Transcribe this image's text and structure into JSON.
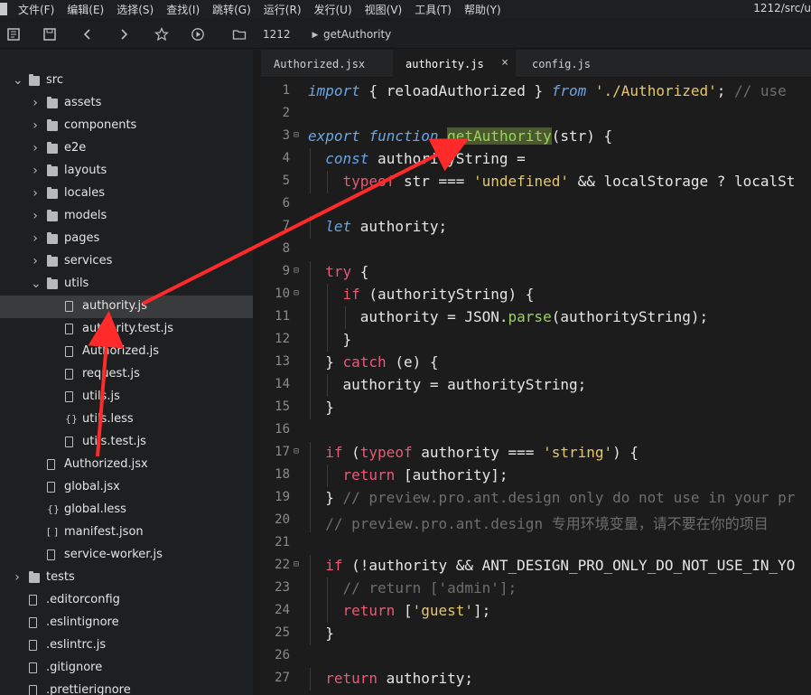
{
  "menubar": {
    "items": [
      "文件(F)",
      "编辑(E)",
      "选择(S)",
      "查找(I)",
      "跳转(G)",
      "运行(R)",
      "发行(U)",
      "视图(V)",
      "工具(T)",
      "帮助(Y)"
    ],
    "path_text": "1212/src/u"
  },
  "toolbar": {
    "project_label": "1212",
    "breadcrumb_label": "getAuthority",
    "icons": [
      "sidebar-toggle-icon",
      "save-icon",
      "back-icon",
      "forward-icon",
      "star-icon",
      "play-icon",
      "folder-view-icon",
      "chevron-right-icon"
    ]
  },
  "sidebar": {
    "items": [
      {
        "label": "src",
        "type": "folder",
        "expanded": true,
        "level": 0
      },
      {
        "label": "assets",
        "type": "folder",
        "expanded": false,
        "level": 1
      },
      {
        "label": "components",
        "type": "folder",
        "expanded": false,
        "level": 1
      },
      {
        "label": "e2e",
        "type": "folder",
        "expanded": false,
        "level": 1
      },
      {
        "label": "layouts",
        "type": "folder",
        "expanded": false,
        "level": 1
      },
      {
        "label": "locales",
        "type": "folder",
        "expanded": false,
        "level": 1
      },
      {
        "label": "models",
        "type": "folder",
        "expanded": false,
        "level": 1
      },
      {
        "label": "pages",
        "type": "folder",
        "expanded": false,
        "level": 1
      },
      {
        "label": "services",
        "type": "folder",
        "expanded": false,
        "level": 1
      },
      {
        "label": "utils",
        "type": "folder",
        "expanded": true,
        "level": 1
      },
      {
        "label": "authority.js",
        "type": "file",
        "level": 2,
        "selected": true
      },
      {
        "label": "authority.test.js",
        "type": "file",
        "level": 2
      },
      {
        "label": "Authorized.js",
        "type": "file",
        "level": 2
      },
      {
        "label": "request.js",
        "type": "file",
        "level": 2
      },
      {
        "label": "utils.js",
        "type": "file",
        "level": 2
      },
      {
        "label": "utils.less",
        "type": "brace",
        "level": 2
      },
      {
        "label": "utils.test.js",
        "type": "file",
        "level": 2
      },
      {
        "label": "Authorized.jsx",
        "type": "file",
        "level": 1
      },
      {
        "label": "global.jsx",
        "type": "file",
        "level": 1
      },
      {
        "label": "global.less",
        "type": "brace",
        "level": 1
      },
      {
        "label": "manifest.json",
        "type": "bracket",
        "level": 1
      },
      {
        "label": "service-worker.js",
        "type": "file",
        "level": 1
      },
      {
        "label": "tests",
        "type": "folder",
        "expanded": false,
        "level": 0
      },
      {
        "label": ".editorconfig",
        "type": "file",
        "level": 0
      },
      {
        "label": ".eslintignore",
        "type": "file",
        "level": 0
      },
      {
        "label": ".eslintrc.js",
        "type": "file",
        "level": 0
      },
      {
        "label": ".gitignore",
        "type": "file",
        "level": 0
      },
      {
        "label": ".prettierignore",
        "type": "file",
        "level": 0
      }
    ]
  },
  "tabs": [
    {
      "label": "Authorized.jsx",
      "active": false
    },
    {
      "label": "authority.js",
      "active": true,
      "close": "×"
    },
    {
      "label": "config.js",
      "active": false
    }
  ],
  "code": [
    {
      "n": "1",
      "fold": "",
      "indent": 0,
      "tokens": [
        [
          "kw",
          "import"
        ],
        [
          "p",
          " { reloadAuthorized } "
        ],
        [
          "kw",
          "from"
        ],
        [
          "p",
          " "
        ],
        [
          "str",
          "'./Authorized'"
        ],
        [
          "p",
          "; "
        ],
        [
          "cm",
          "// use"
        ]
      ]
    },
    {
      "n": "2",
      "fold": "",
      "indent": 0,
      "tokens": []
    },
    {
      "n": "3",
      "fold": "⊟",
      "indent": 0,
      "tokens": [
        [
          "kw",
          "export"
        ],
        [
          "p",
          " "
        ],
        [
          "kw",
          "function"
        ],
        [
          "p",
          " "
        ],
        [
          "hlfn",
          "getAuthority"
        ],
        [
          "p",
          "(str) {"
        ]
      ]
    },
    {
      "n": "4",
      "fold": "",
      "indent": 1,
      "tokens": [
        [
          "kw",
          "const"
        ],
        [
          "p",
          " authorityString ="
        ]
      ]
    },
    {
      "n": "5",
      "fold": "",
      "indent": 2,
      "tokens": [
        [
          "kwr",
          "typeof"
        ],
        [
          "p",
          " str === "
        ],
        [
          "str",
          "'undefined'"
        ],
        [
          "p",
          " && localStorage ? localSt"
        ]
      ]
    },
    {
      "n": "6",
      "fold": "",
      "indent": 0,
      "tokens": []
    },
    {
      "n": "7",
      "fold": "",
      "indent": 1,
      "tokens": [
        [
          "kw",
          "let"
        ],
        [
          "p",
          " authority;"
        ]
      ]
    },
    {
      "n": "8",
      "fold": "",
      "indent": 0,
      "tokens": []
    },
    {
      "n": "9",
      "fold": "⊟",
      "indent": 1,
      "tokens": [
        [
          "kwr",
          "try"
        ],
        [
          "p",
          " {"
        ]
      ]
    },
    {
      "n": "10",
      "fold": "⊟",
      "indent": 2,
      "tokens": [
        [
          "kwr",
          "if"
        ],
        [
          "p",
          " (authorityString) {"
        ]
      ]
    },
    {
      "n": "11",
      "fold": "",
      "indent": 3,
      "tokens": [
        [
          "p",
          "authority = JSON."
        ],
        [
          "fn",
          "parse"
        ],
        [
          "p",
          "(authorityString);"
        ]
      ]
    },
    {
      "n": "12",
      "fold": "",
      "indent": 2,
      "tokens": [
        [
          "p",
          "}"
        ]
      ]
    },
    {
      "n": "13",
      "fold": "",
      "indent": 1,
      "tokens": [
        [
          "p",
          "} "
        ],
        [
          "kwr",
          "catch"
        ],
        [
          "p",
          " (e) {"
        ]
      ]
    },
    {
      "n": "14",
      "fold": "",
      "indent": 2,
      "tokens": [
        [
          "p",
          "authority = authorityString;"
        ]
      ]
    },
    {
      "n": "15",
      "fold": "",
      "indent": 1,
      "tokens": [
        [
          "p",
          "}"
        ]
      ]
    },
    {
      "n": "16",
      "fold": "",
      "indent": 0,
      "tokens": []
    },
    {
      "n": "17",
      "fold": "⊟",
      "indent": 1,
      "tokens": [
        [
          "kwr",
          "if"
        ],
        [
          "p",
          " ("
        ],
        [
          "kwr",
          "typeof"
        ],
        [
          "p",
          " authority === "
        ],
        [
          "str",
          "'string'"
        ],
        [
          "p",
          ") {"
        ]
      ]
    },
    {
      "n": "18",
      "fold": "",
      "indent": 2,
      "tokens": [
        [
          "kwr",
          "return"
        ],
        [
          "p",
          " [authority];"
        ]
      ]
    },
    {
      "n": "19",
      "fold": "",
      "indent": 1,
      "tokens": [
        [
          "p",
          "} "
        ],
        [
          "cm",
          "// preview.pro.ant.design only do not use in your pr"
        ]
      ]
    },
    {
      "n": "20",
      "fold": "",
      "indent": 1,
      "tokens": [
        [
          "cm",
          "// preview.pro.ant.design 专用环境变量，请不要在你的项目"
        ]
      ]
    },
    {
      "n": "21",
      "fold": "",
      "indent": 0,
      "tokens": []
    },
    {
      "n": "22",
      "fold": "⊟",
      "indent": 1,
      "tokens": [
        [
          "kwr",
          "if"
        ],
        [
          "p",
          " (!authority && ANT_DESIGN_PRO_ONLY_DO_NOT_USE_IN_YO"
        ]
      ]
    },
    {
      "n": "23",
      "fold": "",
      "indent": 2,
      "tokens": [
        [
          "cm",
          "// return ['admin'];"
        ]
      ]
    },
    {
      "n": "24",
      "fold": "",
      "indent": 2,
      "tokens": [
        [
          "kwr",
          "return"
        ],
        [
          "p",
          " ["
        ],
        [
          "str",
          "'guest'"
        ],
        [
          "p",
          "];"
        ]
      ]
    },
    {
      "n": "25",
      "fold": "",
      "indent": 1,
      "tokens": [
        [
          "p",
          "}"
        ]
      ]
    },
    {
      "n": "26",
      "fold": "",
      "indent": 0,
      "tokens": []
    },
    {
      "n": "27",
      "fold": "",
      "indent": 1,
      "tokens": [
        [
          "kwr",
          "return"
        ],
        [
          "p",
          " authority;"
        ]
      ]
    }
  ],
  "colors": {
    "annotation_arrow": "#ff2a2a",
    "keyword_blue": "#6aa6e6",
    "keyword_red": "#ea5a76",
    "string": "#e6c76a",
    "comment": "#6e6e6e",
    "function": "#9ad35b"
  }
}
